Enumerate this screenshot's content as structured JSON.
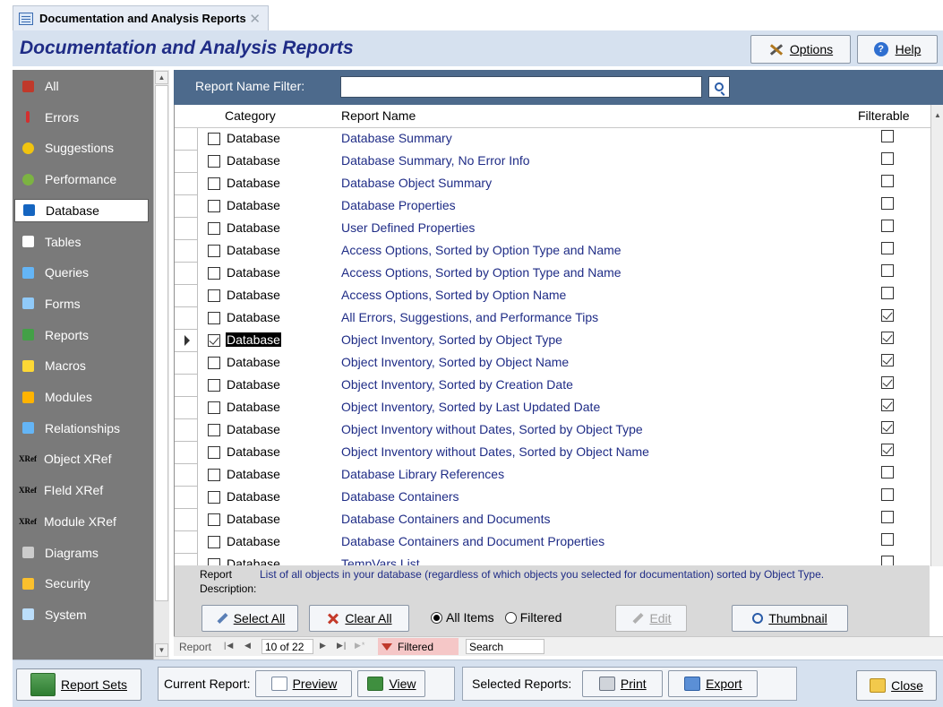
{
  "tab": {
    "title": "Documentation and Analysis Reports",
    "close": "✕"
  },
  "header": {
    "title": "Documentation and Analysis Reports",
    "options_label": "Options",
    "options_accel": "O",
    "help_label": "Help",
    "help_accel": "H"
  },
  "sidebar": {
    "items": [
      {
        "label": "All",
        "icon": "all-icon",
        "selected": false
      },
      {
        "label": "Errors",
        "icon": "error-icon",
        "selected": false
      },
      {
        "label": "Suggestions",
        "icon": "lightbulb-icon",
        "selected": false
      },
      {
        "label": "Performance",
        "icon": "performance-icon",
        "selected": false
      },
      {
        "label": "Database",
        "icon": "database-icon",
        "selected": true
      },
      {
        "label": "Tables",
        "icon": "table-icon",
        "selected": false
      },
      {
        "label": "Queries",
        "icon": "query-icon",
        "selected": false
      },
      {
        "label": "Forms",
        "icon": "form-icon",
        "selected": false
      },
      {
        "label": "Reports",
        "icon": "report-icon",
        "selected": false
      },
      {
        "label": "Macros",
        "icon": "macro-icon",
        "selected": false
      },
      {
        "label": "Modules",
        "icon": "module-icon",
        "selected": false
      },
      {
        "label": "Relationships",
        "icon": "relationships-icon",
        "selected": false
      },
      {
        "label": "Object XRef",
        "icon": "xref-icon",
        "selected": false
      },
      {
        "label": "FIeld XRef",
        "icon": "xref-icon",
        "selected": false
      },
      {
        "label": "Module XRef",
        "icon": "xref-icon",
        "selected": false
      },
      {
        "label": "Diagrams",
        "icon": "diagram-icon",
        "selected": false
      },
      {
        "label": "Security",
        "icon": "security-icon",
        "selected": false
      },
      {
        "label": "System",
        "icon": "system-icon",
        "selected": false
      }
    ],
    "xref_icon_text": "XRef"
  },
  "filter": {
    "label": "Report Name Filter:",
    "value": ""
  },
  "grid": {
    "headers": {
      "category": "Category",
      "report_name": "Report Name",
      "filterable": "Filterable"
    },
    "rows": [
      {
        "selected": false,
        "category": "Database",
        "name": "Database Summary",
        "filterable": false,
        "current": false
      },
      {
        "selected": false,
        "category": "Database",
        "name": "Database Summary, No Error Info",
        "filterable": false,
        "current": false
      },
      {
        "selected": false,
        "category": "Database",
        "name": "Database Object Summary",
        "filterable": false,
        "current": false
      },
      {
        "selected": false,
        "category": "Database",
        "name": "Database Properties",
        "filterable": false,
        "current": false
      },
      {
        "selected": false,
        "category": "Database",
        "name": "User Defined Properties",
        "filterable": false,
        "current": false
      },
      {
        "selected": false,
        "category": "Database",
        "name": "Access Options, Sorted by Option Type and Name",
        "filterable": false,
        "current": false
      },
      {
        "selected": false,
        "category": "Database",
        "name": "Access Options, Sorted by Option Type and Name",
        "filterable": false,
        "current": false
      },
      {
        "selected": false,
        "category": "Database",
        "name": "Access Options, Sorted by Option Name",
        "filterable": false,
        "current": false
      },
      {
        "selected": false,
        "category": "Database",
        "name": "All Errors, Suggestions, and Performance Tips",
        "filterable": true,
        "current": false
      },
      {
        "selected": true,
        "category": "Database",
        "name": "Object Inventory, Sorted by Object Type",
        "filterable": true,
        "current": true
      },
      {
        "selected": false,
        "category": "Database",
        "name": "Object Inventory, Sorted by Object Name",
        "filterable": true,
        "current": false
      },
      {
        "selected": false,
        "category": "Database",
        "name": "Object Inventory, Sorted by Creation Date",
        "filterable": true,
        "current": false
      },
      {
        "selected": false,
        "category": "Database",
        "name": "Object Inventory, Sorted by Last Updated Date",
        "filterable": true,
        "current": false
      },
      {
        "selected": false,
        "category": "Database",
        "name": "Object Inventory without Dates, Sorted by Object Type",
        "filterable": true,
        "current": false
      },
      {
        "selected": false,
        "category": "Database",
        "name": "Object Inventory without Dates, Sorted by Object Name",
        "filterable": true,
        "current": false
      },
      {
        "selected": false,
        "category": "Database",
        "name": "Database Library References",
        "filterable": false,
        "current": false
      },
      {
        "selected": false,
        "category": "Database",
        "name": "Database Containers",
        "filterable": false,
        "current": false
      },
      {
        "selected": false,
        "category": "Database",
        "name": "Database Containers and Documents",
        "filterable": false,
        "current": false
      },
      {
        "selected": false,
        "category": "Database",
        "name": "Database Containers and Document Properties",
        "filterable": false,
        "current": false
      },
      {
        "selected": false,
        "category": "Database",
        "name": "TempVars List",
        "filterable": false,
        "current": false
      }
    ]
  },
  "description": {
    "label_line1": "Report",
    "label_line2": "Description:",
    "text": "List of all objects in your database (regardless of which objects you selected for documentation) sorted by Object Type."
  },
  "actions": {
    "select_all": "Select All",
    "select_all_accel": "S",
    "clear_all": "Clear All",
    "clear_all_accel": "A",
    "all_items": "All Items",
    "filtered": "Filtered",
    "edit": "Edit",
    "thumbnail": "Thumbnail",
    "thumbnail_accel": "T"
  },
  "nav": {
    "record_label": "Report",
    "first": "⏮",
    "prev": "◀",
    "position": "10 of 22",
    "next": "▶",
    "last": "⏭",
    "new": "▶*",
    "filter_status": "Filtered",
    "search": "Search"
  },
  "bottom": {
    "report_sets": "Report Sets",
    "report_sets_accel": "S",
    "current_report_label": "Current Report:",
    "preview": "Preview",
    "preview_accel": "v",
    "view": "View",
    "view_accel": "w",
    "selected_reports_label": "Selected Reports:",
    "print": "Print",
    "print_accel": "P",
    "export": "Export",
    "export_accel": "x",
    "close": "Close",
    "close_accel": "C"
  },
  "colors": {
    "title": "#1f2c86",
    "filter_bar": "#4d6a8c",
    "sidebar": "#7a7a7a",
    "header_bg": "#d6e1ef",
    "filtered_bg": "#f5c7c7"
  }
}
